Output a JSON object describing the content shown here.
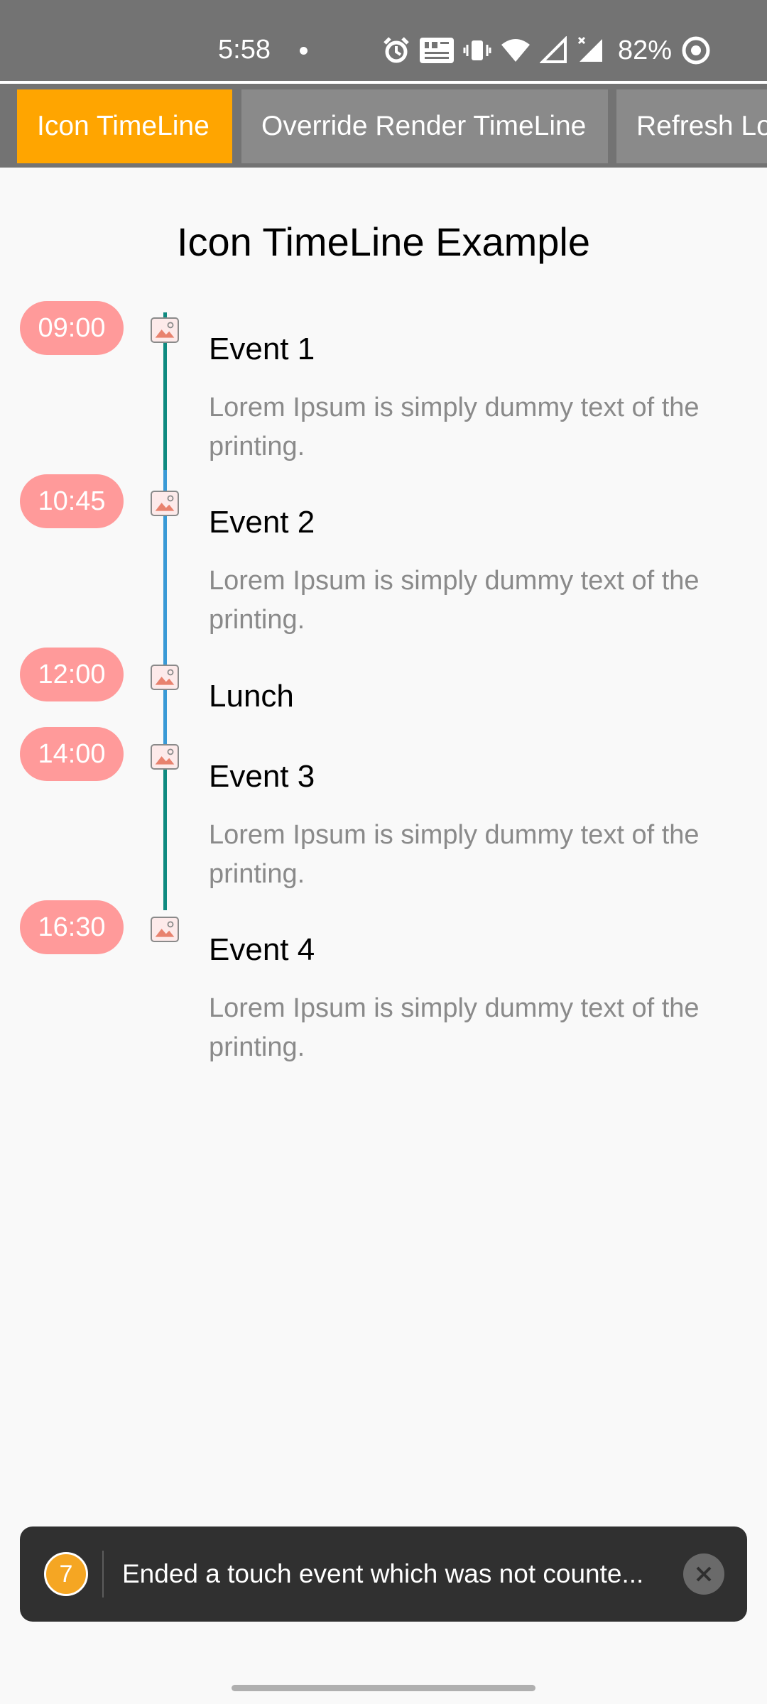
{
  "status_bar": {
    "time": "5:58",
    "battery": "82%",
    "icons": [
      "alarm-icon",
      "volte-icon",
      "vibrate-icon",
      "wifi-icon",
      "signal-icon",
      "signal-x-icon",
      "battery-ring-icon"
    ]
  },
  "tabs": [
    {
      "label": "Icon TimeLine",
      "active": true
    },
    {
      "label": "Override Render TimeLine",
      "active": false
    },
    {
      "label": "Refresh Lo",
      "active": false
    }
  ],
  "page": {
    "title": "Icon TimeLine Example"
  },
  "timeline": {
    "events": [
      {
        "time": "09:00",
        "title": "Event 1",
        "description": "Lorem Ipsum is simply dummy text of the printing."
      },
      {
        "time": "10:45",
        "title": "Event 2",
        "description": "Lorem Ipsum is simply dummy text of the printing."
      },
      {
        "time": "12:00",
        "title": "Lunch",
        "description": ""
      },
      {
        "time": "14:00",
        "title": "Event 3",
        "description": "Lorem Ipsum is simply dummy text of the printing."
      },
      {
        "time": "16:30",
        "title": "Event 4",
        "description": "Lorem Ipsum is simply dummy text of the printing."
      }
    ],
    "colors": {
      "line_teal": "#0f8a80",
      "line_blue": "#3a9ad6",
      "pill": "#ff9a9a"
    }
  },
  "toast": {
    "badge": "7",
    "message": "Ended a touch event which was not counte..."
  },
  "colors": {
    "accent_tab": "#ffa500",
    "status_bar": "#737373"
  }
}
